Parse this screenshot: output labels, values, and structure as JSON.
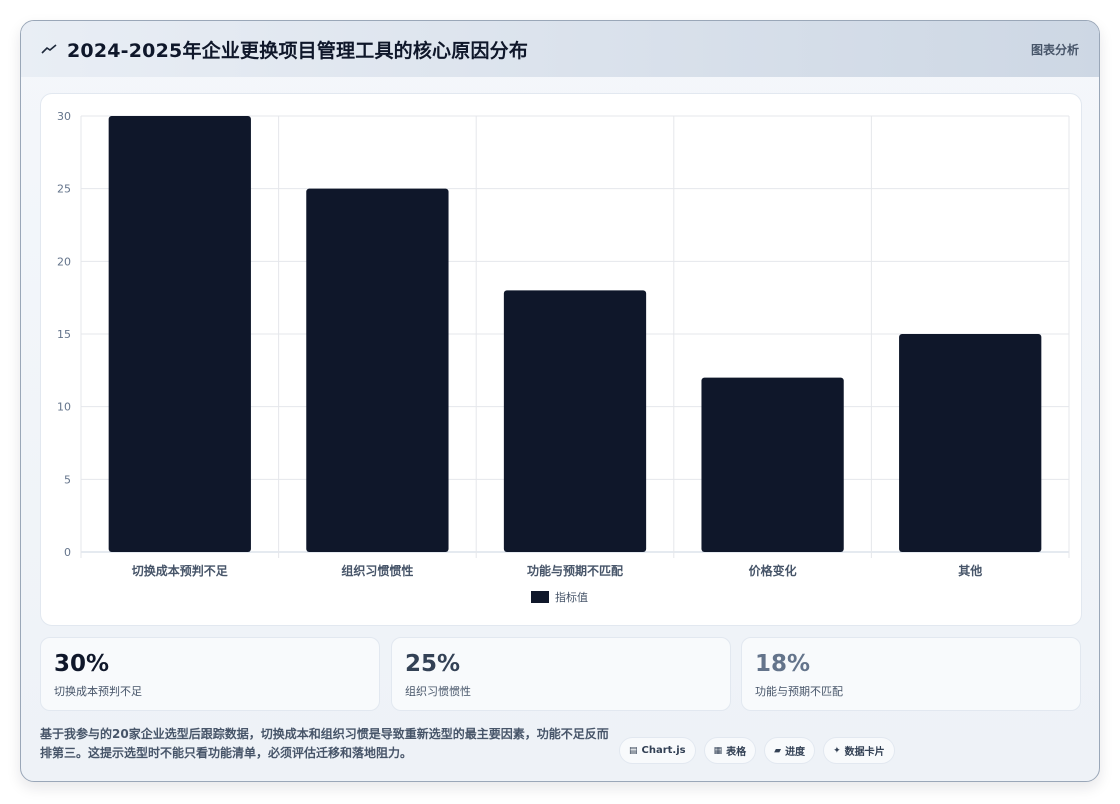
{
  "header": {
    "title": "2024-2025年企业更换项目管理工具的核心原因分布",
    "tag": "图表分析"
  },
  "chart_data": {
    "type": "bar",
    "categories": [
      "切换成本预判不足",
      "组织习惯惯性",
      "功能与预期不匹配",
      "价格变化",
      "其他"
    ],
    "series": [
      {
        "name": "指标值",
        "values": [
          30,
          25,
          18,
          12,
          15
        ]
      }
    ],
    "ylim": [
      0,
      30
    ],
    "yticks": [
      0,
      5,
      10,
      15,
      20,
      25,
      30
    ],
    "grid": true,
    "legend": "bottom",
    "bar_color": "#0f172a"
  },
  "stats": [
    {
      "value": "30%",
      "label": "切换成本预判不足",
      "color": "#0f172a"
    },
    {
      "value": "25%",
      "label": "组织习惯惯性",
      "color": "#334155"
    },
    {
      "value": "18%",
      "label": "功能与预期不匹配",
      "color": "#64748b"
    }
  ],
  "footer": {
    "text": "基于我参与的20家企业选型后跟踪数据，切换成本和组织习惯是导致重新选型的最主要因素，功能不足反而排第三。这提示选型时不能只看功能清单，必须评估迁移和落地阻力。"
  },
  "chips": [
    {
      "icon": "▤",
      "icon_name": "chart-icon",
      "label": "Chart.js"
    },
    {
      "icon": "▦",
      "icon_name": "table-icon",
      "label": "表格"
    },
    {
      "icon": "▰",
      "icon_name": "progress-icon",
      "label": "进度"
    },
    {
      "icon": "✦",
      "icon_name": "card-icon",
      "label": "数据卡片"
    }
  ]
}
